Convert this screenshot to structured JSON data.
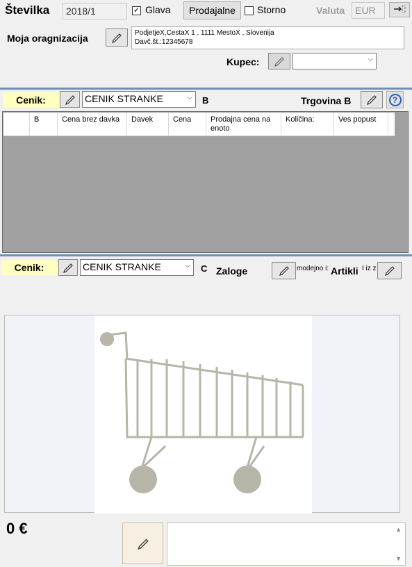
{
  "header": {
    "stevilka_label": "Številka",
    "stevilka_value": "2018/1",
    "glava_label": "Glava",
    "glava_checked": true,
    "prodajalne_label": "Prodajalne",
    "storno_label": "Storno",
    "storno_checked": false,
    "valuta_label": "Valuta",
    "valuta_value": "EUR"
  },
  "organization": {
    "label": "Moja oragnizacija",
    "line1": "PodjetjeX,CestaX 1 , 1111 MestoX , Slovenija",
    "line2": "Davč.št.:12345678"
  },
  "customer": {
    "label": "Kupec:",
    "value": ""
  },
  "pricelist_top": {
    "label": "Cenik:",
    "value": "CENIK STRANKE",
    "tag": "B",
    "store_label": "Trgovina B",
    "help_icon": "question-circle-icon"
  },
  "grid": {
    "columns": [
      "",
      "B",
      "Cena brez davka",
      "Davek",
      "Cena",
      "Prodajna cena na enoto",
      "Količina:",
      "Ves popust"
    ],
    "rows": []
  },
  "pricelist_bottom": {
    "label": "Cenik:",
    "value": "CENIK STRANKE",
    "tag": "C",
    "zaloge_label": "Zaloge",
    "hint1": "modejno i:",
    "artikli_label": "Artikli",
    "hint2": "I iz z"
  },
  "footer": {
    "total": "0 €",
    "notes": ""
  },
  "colors": {
    "cenik_bg": "#ffffc0",
    "grid_bg": "#a0a0a0",
    "cart_color": "#b7b4a8"
  }
}
